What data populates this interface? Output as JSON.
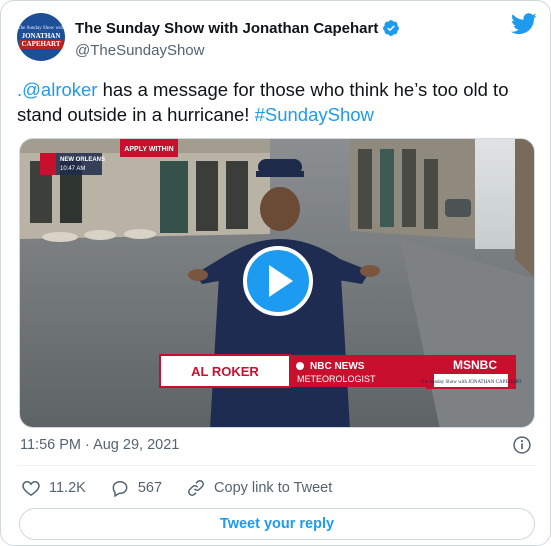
{
  "account": {
    "display_name": "The Sunday Show with Jonathan Capehart",
    "handle": "@TheSundayShow",
    "avatar_text": [
      "The Sunday Show with",
      "JONATHAN",
      "CAPEHART"
    ]
  },
  "tweet": {
    "mention": ".@alroker",
    "text": " has a message for those who think he’s too old to stand outside in a hurricane! ",
    "hashtag": "#SundayShow",
    "timestamp": "11:56 PM · Aug 29, 2021"
  },
  "video": {
    "location_bug": "NEW ORLEANS",
    "time_bug": "10:47 AM",
    "sign_text": "APPLY WITHIN",
    "lower_third_name": "AL ROKER",
    "lower_third_org": "NBC NEWS",
    "lower_third_title": "METEOROLOGIST",
    "network": "MSNBC",
    "show_tag": "The Sunday Show with JONATHAN CAPEHART"
  },
  "actions": {
    "likes": "11.2K",
    "replies": "567",
    "copy_link": "Copy link to Tweet",
    "reply_button": "Tweet your reply"
  },
  "colors": {
    "accent": "#1d9bf0",
    "verified": "#1d9bf0",
    "lower_third_red": "#c8102e"
  },
  "icons": [
    "verified-badge-icon",
    "twitter-bird-icon",
    "play-icon",
    "info-icon",
    "heart-icon",
    "reply-bubble-icon",
    "link-icon"
  ]
}
